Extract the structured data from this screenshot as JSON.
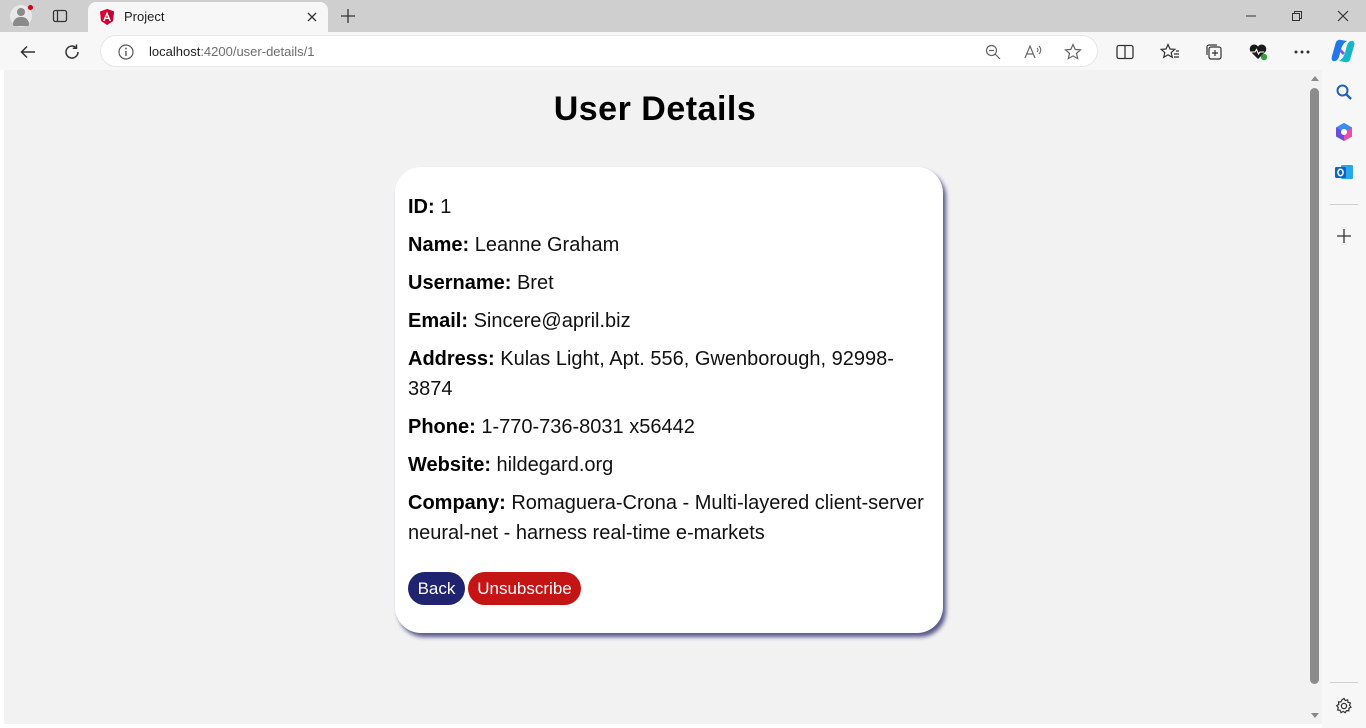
{
  "browser": {
    "tab": {
      "title": "Project",
      "favicon": "angular-logo-icon"
    },
    "address": {
      "host": "localhost",
      "path": ":4200/user-details/1"
    },
    "colors": {
      "accent": "#dd0031"
    }
  },
  "page": {
    "title": "User Details",
    "fields": [
      {
        "label": "ID:",
        "value": "1"
      },
      {
        "label": "Name:",
        "value": "Leanne Graham"
      },
      {
        "label": "Username:",
        "value": "Bret"
      },
      {
        "label": "Email:",
        "value": "Sincere@april.biz"
      },
      {
        "label": "Address:",
        "value": "Kulas Light, Apt. 556, Gwenborough, 92998-3874"
      },
      {
        "label": "Phone:",
        "value": "1-770-736-8031 x56442"
      },
      {
        "label": "Website:",
        "value": "hildegard.org"
      },
      {
        "label": "Company:",
        "value": "Romaguera-Crona - Multi-layered client-server neural-net - harness real-time e-markets"
      }
    ],
    "buttons": {
      "back": "Back",
      "unsubscribe": "Unsubscribe"
    },
    "colors": {
      "back_button": "#1f2370",
      "unsubscribe_button": "#c41414",
      "background": "#f2f2f3"
    }
  }
}
